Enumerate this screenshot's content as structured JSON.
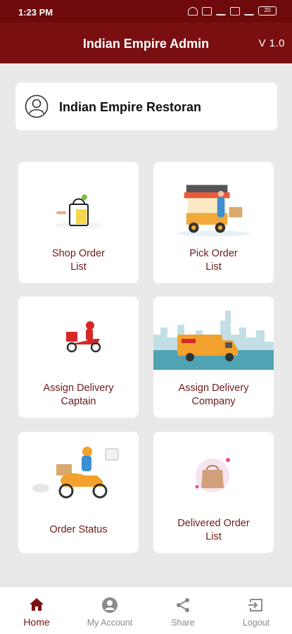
{
  "status_bar": {
    "time": "1:23 PM",
    "battery": "20"
  },
  "app_bar": {
    "title": "Indian Empire Admin",
    "version": "V 1.0"
  },
  "restaurant": {
    "name": "Indian Empire Restoran"
  },
  "tiles": [
    {
      "line1": "Shop Order",
      "line2": "List",
      "icon": "shopping-bag-icon"
    },
    {
      "line1": "Pick Order",
      "line2": "List",
      "icon": "restaurant-cart-icon"
    },
    {
      "line1": "Assign Delivery",
      "line2": "Captain",
      "icon": "delivery-scooter-icon"
    },
    {
      "line1": "Assign Delivery",
      "line2": "Company",
      "icon": "delivery-truck-icon"
    },
    {
      "line1": "Order Status",
      "line2": "",
      "icon": "delivery-rider-icon"
    },
    {
      "line1": "Delivered Order",
      "line2": "List",
      "icon": "delivered-package-icon"
    }
  ],
  "bottom_nav": [
    {
      "label": "Home",
      "icon": "home-icon",
      "active": true
    },
    {
      "label": "My Account",
      "icon": "account-icon",
      "active": false
    },
    {
      "label": "Share",
      "icon": "share-icon",
      "active": false
    },
    {
      "label": "Logout",
      "icon": "logout-icon",
      "active": false
    }
  ],
  "colors": {
    "primary": "#7a0f12",
    "statusbar": "#6e0a0c",
    "background": "#e9e9e9",
    "label": "#6e1a1a"
  }
}
